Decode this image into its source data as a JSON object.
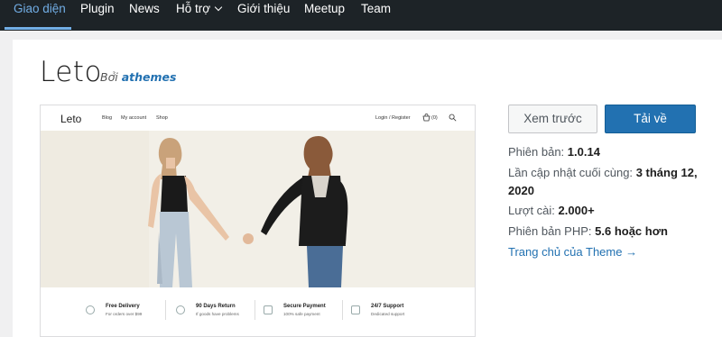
{
  "nav": {
    "items": [
      "Giao diện",
      "Plugin",
      "News",
      "Hỗ trợ",
      "Giới thiệu",
      "Meetup",
      "Team"
    ]
  },
  "theme": {
    "name": "Leto",
    "by_prefix": "Bởi",
    "author": "athemes"
  },
  "preview": {
    "logo": "Leto",
    "menu": [
      "Blog",
      "My account",
      "Shop"
    ],
    "login": "Login / Register",
    "cart": "(0)",
    "features": [
      {
        "title": "Free Delivery",
        "sub": "For orders over $99"
      },
      {
        "title": "90 Days Return",
        "sub": "If goods have problems"
      },
      {
        "title": "Secure Payment",
        "sub": "100% safe payment"
      },
      {
        "title": "24/7 Support",
        "sub": "Dedicated support"
      }
    ]
  },
  "actions": {
    "preview_label": "Xem trước",
    "download_label": "Tải về"
  },
  "meta": {
    "version_label": "Phiên bản:",
    "version_value": "1.0.14",
    "updated_label": "Lần cập nhật cuối cùng:",
    "updated_value_1": "3 tháng 12,",
    "updated_value_2": "2020",
    "installs_label": "Lượt cài:",
    "installs_value": "2.000+",
    "php_label": "Phiên bản PHP:",
    "php_value": "5.6 hoặc hơn",
    "homepage_link": "Trang chủ của Theme →"
  },
  "colors": {
    "nav_bg": "#1d2327",
    "accent": "#72aee6",
    "primary": "#2271b1"
  }
}
